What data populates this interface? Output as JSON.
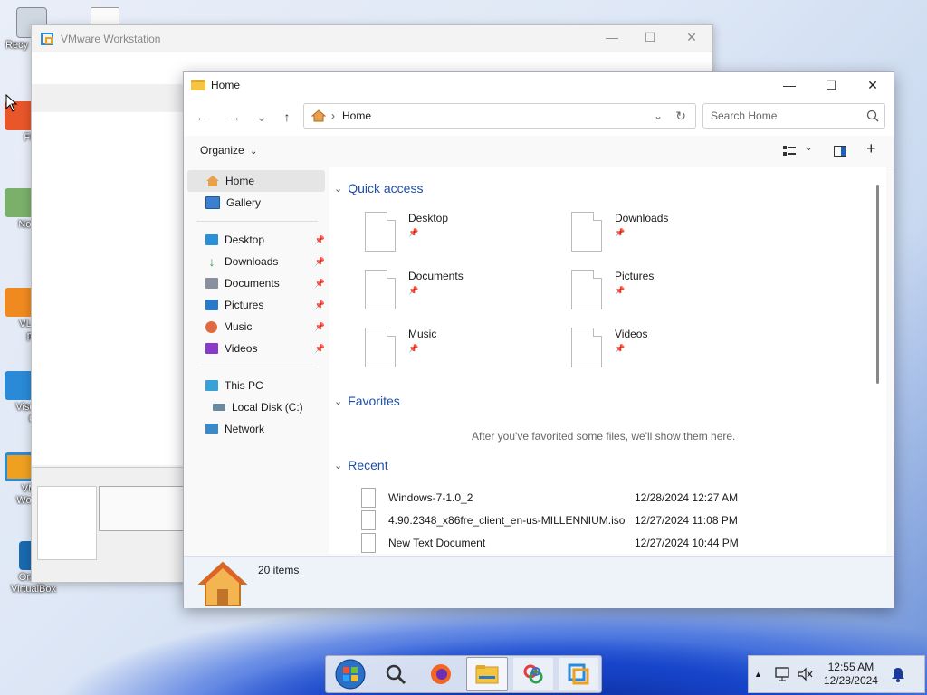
{
  "desktop": {
    "icons": [
      {
        "label": "Recy",
        "icon": "recycle-bin-icon"
      },
      {
        "label": "Fi",
        "icon": "firefox-shortcut-icon"
      },
      {
        "label": "Note",
        "icon": "notepad-shortcut-icon"
      },
      {
        "label": "VLC",
        "label2": "pl",
        "icon": "vlc-icon"
      },
      {
        "label": "Visua",
        "label2": "C",
        "icon": "vscode-icon"
      },
      {
        "label": "VM",
        "label2": "Work",
        "icon": "vmware-icon"
      },
      {
        "label": "Oracle",
        "label2": "VirtualBox",
        "icon": "virtualbox-icon"
      }
    ]
  },
  "vmware": {
    "title": "VMware Workstation",
    "min": "—",
    "max": "☐",
    "close": "✕"
  },
  "explorer": {
    "title": "Home",
    "controls": {
      "min": "—",
      "max": "☐",
      "close": "✕"
    },
    "nav": {
      "back": "←",
      "forward": "→",
      "recent": "⌄",
      "up": "↑"
    },
    "address": {
      "sep": "›",
      "location": "Home",
      "dropdown": "⌄",
      "refresh": "↻"
    },
    "search": {
      "placeholder": "Search Home"
    },
    "cmdbar": {
      "organize": "Organize",
      "organize_chev": "⌄",
      "view_chev": "⌄",
      "add": "+"
    },
    "sidebar": {
      "top": [
        {
          "label": "Home",
          "icon": "home-icon",
          "color": "#e8a04a"
        },
        {
          "label": "Gallery",
          "icon": "gallery-icon",
          "color": "#3a7fd0"
        }
      ],
      "pinned": [
        {
          "label": "Desktop",
          "icon": "desktop-icon",
          "color": "#2a90d8"
        },
        {
          "label": "Downloads",
          "icon": "downloads-icon",
          "color": "#2aa050"
        },
        {
          "label": "Documents",
          "icon": "documents-icon",
          "color": "#8a8fa0"
        },
        {
          "label": "Pictures",
          "icon": "pictures-icon",
          "color": "#2a78c8"
        },
        {
          "label": "Music",
          "icon": "music-icon",
          "color": "#e06a40"
        },
        {
          "label": "Videos",
          "icon": "videos-icon",
          "color": "#8a3ac8"
        }
      ],
      "pc": [
        {
          "label": "This PC",
          "icon": "this-pc-icon",
          "color": "#3aa0d8"
        },
        {
          "label": "Local Disk (C:)",
          "icon": "local-disk-icon",
          "color": "#6a8aa0"
        },
        {
          "label": "Network",
          "icon": "network-icon",
          "color": "#3a8ac8"
        }
      ]
    },
    "quick_access": {
      "title": "Quick access",
      "items": [
        "Desktop",
        "Downloads",
        "Documents",
        "Pictures",
        "Music",
        "Videos"
      ]
    },
    "favorites": {
      "title": "Favorites",
      "empty": "After you've favorited some files, we'll show them here."
    },
    "recent": {
      "title": "Recent",
      "rows": [
        {
          "name": "Windows-7-1.0_2",
          "date": "12/28/2024 12:27 AM"
        },
        {
          "name": "4.90.2348_x86fre_client_en-us-MILLENNIUM.iso",
          "date": "12/27/2024 11:08 PM"
        },
        {
          "name": "New Text Document",
          "date": "12/27/2024 10:44 PM"
        }
      ]
    },
    "status": {
      "count": "20 items"
    }
  },
  "taskbar": {
    "apps": [
      "start-orb-icon",
      "search-icon",
      "firefox-icon",
      "file-explorer-icon",
      "app-icon",
      "vmware-taskbar-icon"
    ]
  },
  "tray": {
    "time": "12:55 AM",
    "date": "12/28/2024",
    "chevron": "▲"
  },
  "colors": {
    "accent": "#1e4ea8",
    "folder": "#f5c542"
  }
}
